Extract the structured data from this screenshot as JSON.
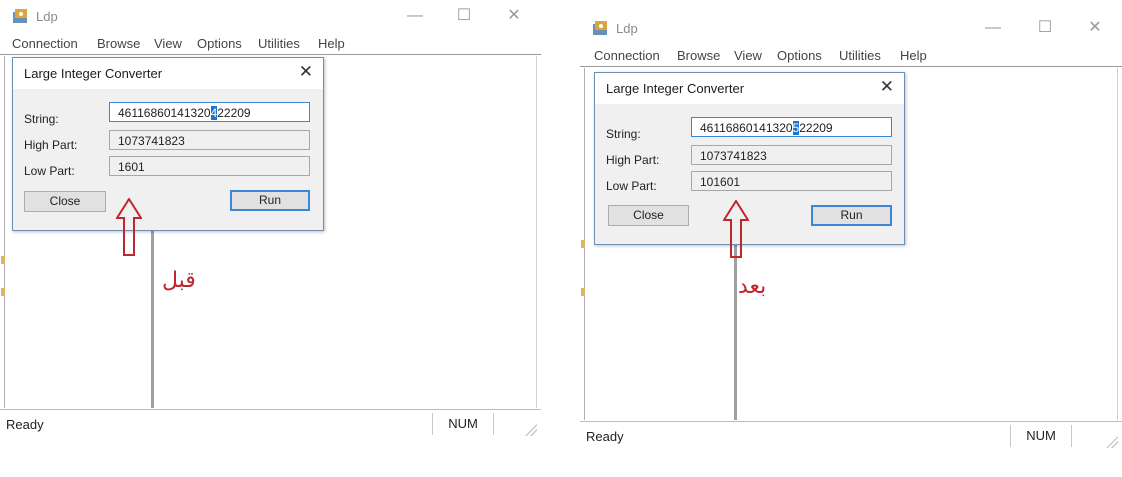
{
  "colors": {
    "annotation": "#c0262d",
    "focus_border": "#3a87d6",
    "dialog_bg": "#f0f0f0"
  },
  "panels": [
    {
      "app_title": "Ldp",
      "menu": [
        "Connection",
        "Browse",
        "View",
        "Options",
        "Utilities",
        "Help"
      ],
      "dialog": {
        "title": "Large Integer Converter",
        "string_label": "String:",
        "string_before": "46116860141320",
        "string_selected": "4",
        "string_after": "22209",
        "high_label": "High Part:",
        "high_value": "1073741823",
        "low_label": "Low Part:",
        "low_value": "1601",
        "close_label": "Close",
        "run_label": "Run"
      },
      "status": "Ready",
      "num": "NUM",
      "annotation": "قبل"
    },
    {
      "app_title": "Ldp",
      "menu": [
        "Connection",
        "Browse",
        "View",
        "Options",
        "Utilities",
        "Help"
      ],
      "dialog": {
        "title": "Large Integer Converter",
        "string_label": "String:",
        "string_before": "46116860141320",
        "string_selected": "5",
        "string_after": "22209",
        "high_label": "High Part:",
        "high_value": "1073741823",
        "low_label": "Low Part:",
        "low_value": "101601",
        "close_label": "Close",
        "run_label": "Run"
      },
      "status": "Ready",
      "num": "NUM",
      "annotation": "بعد"
    }
  ]
}
